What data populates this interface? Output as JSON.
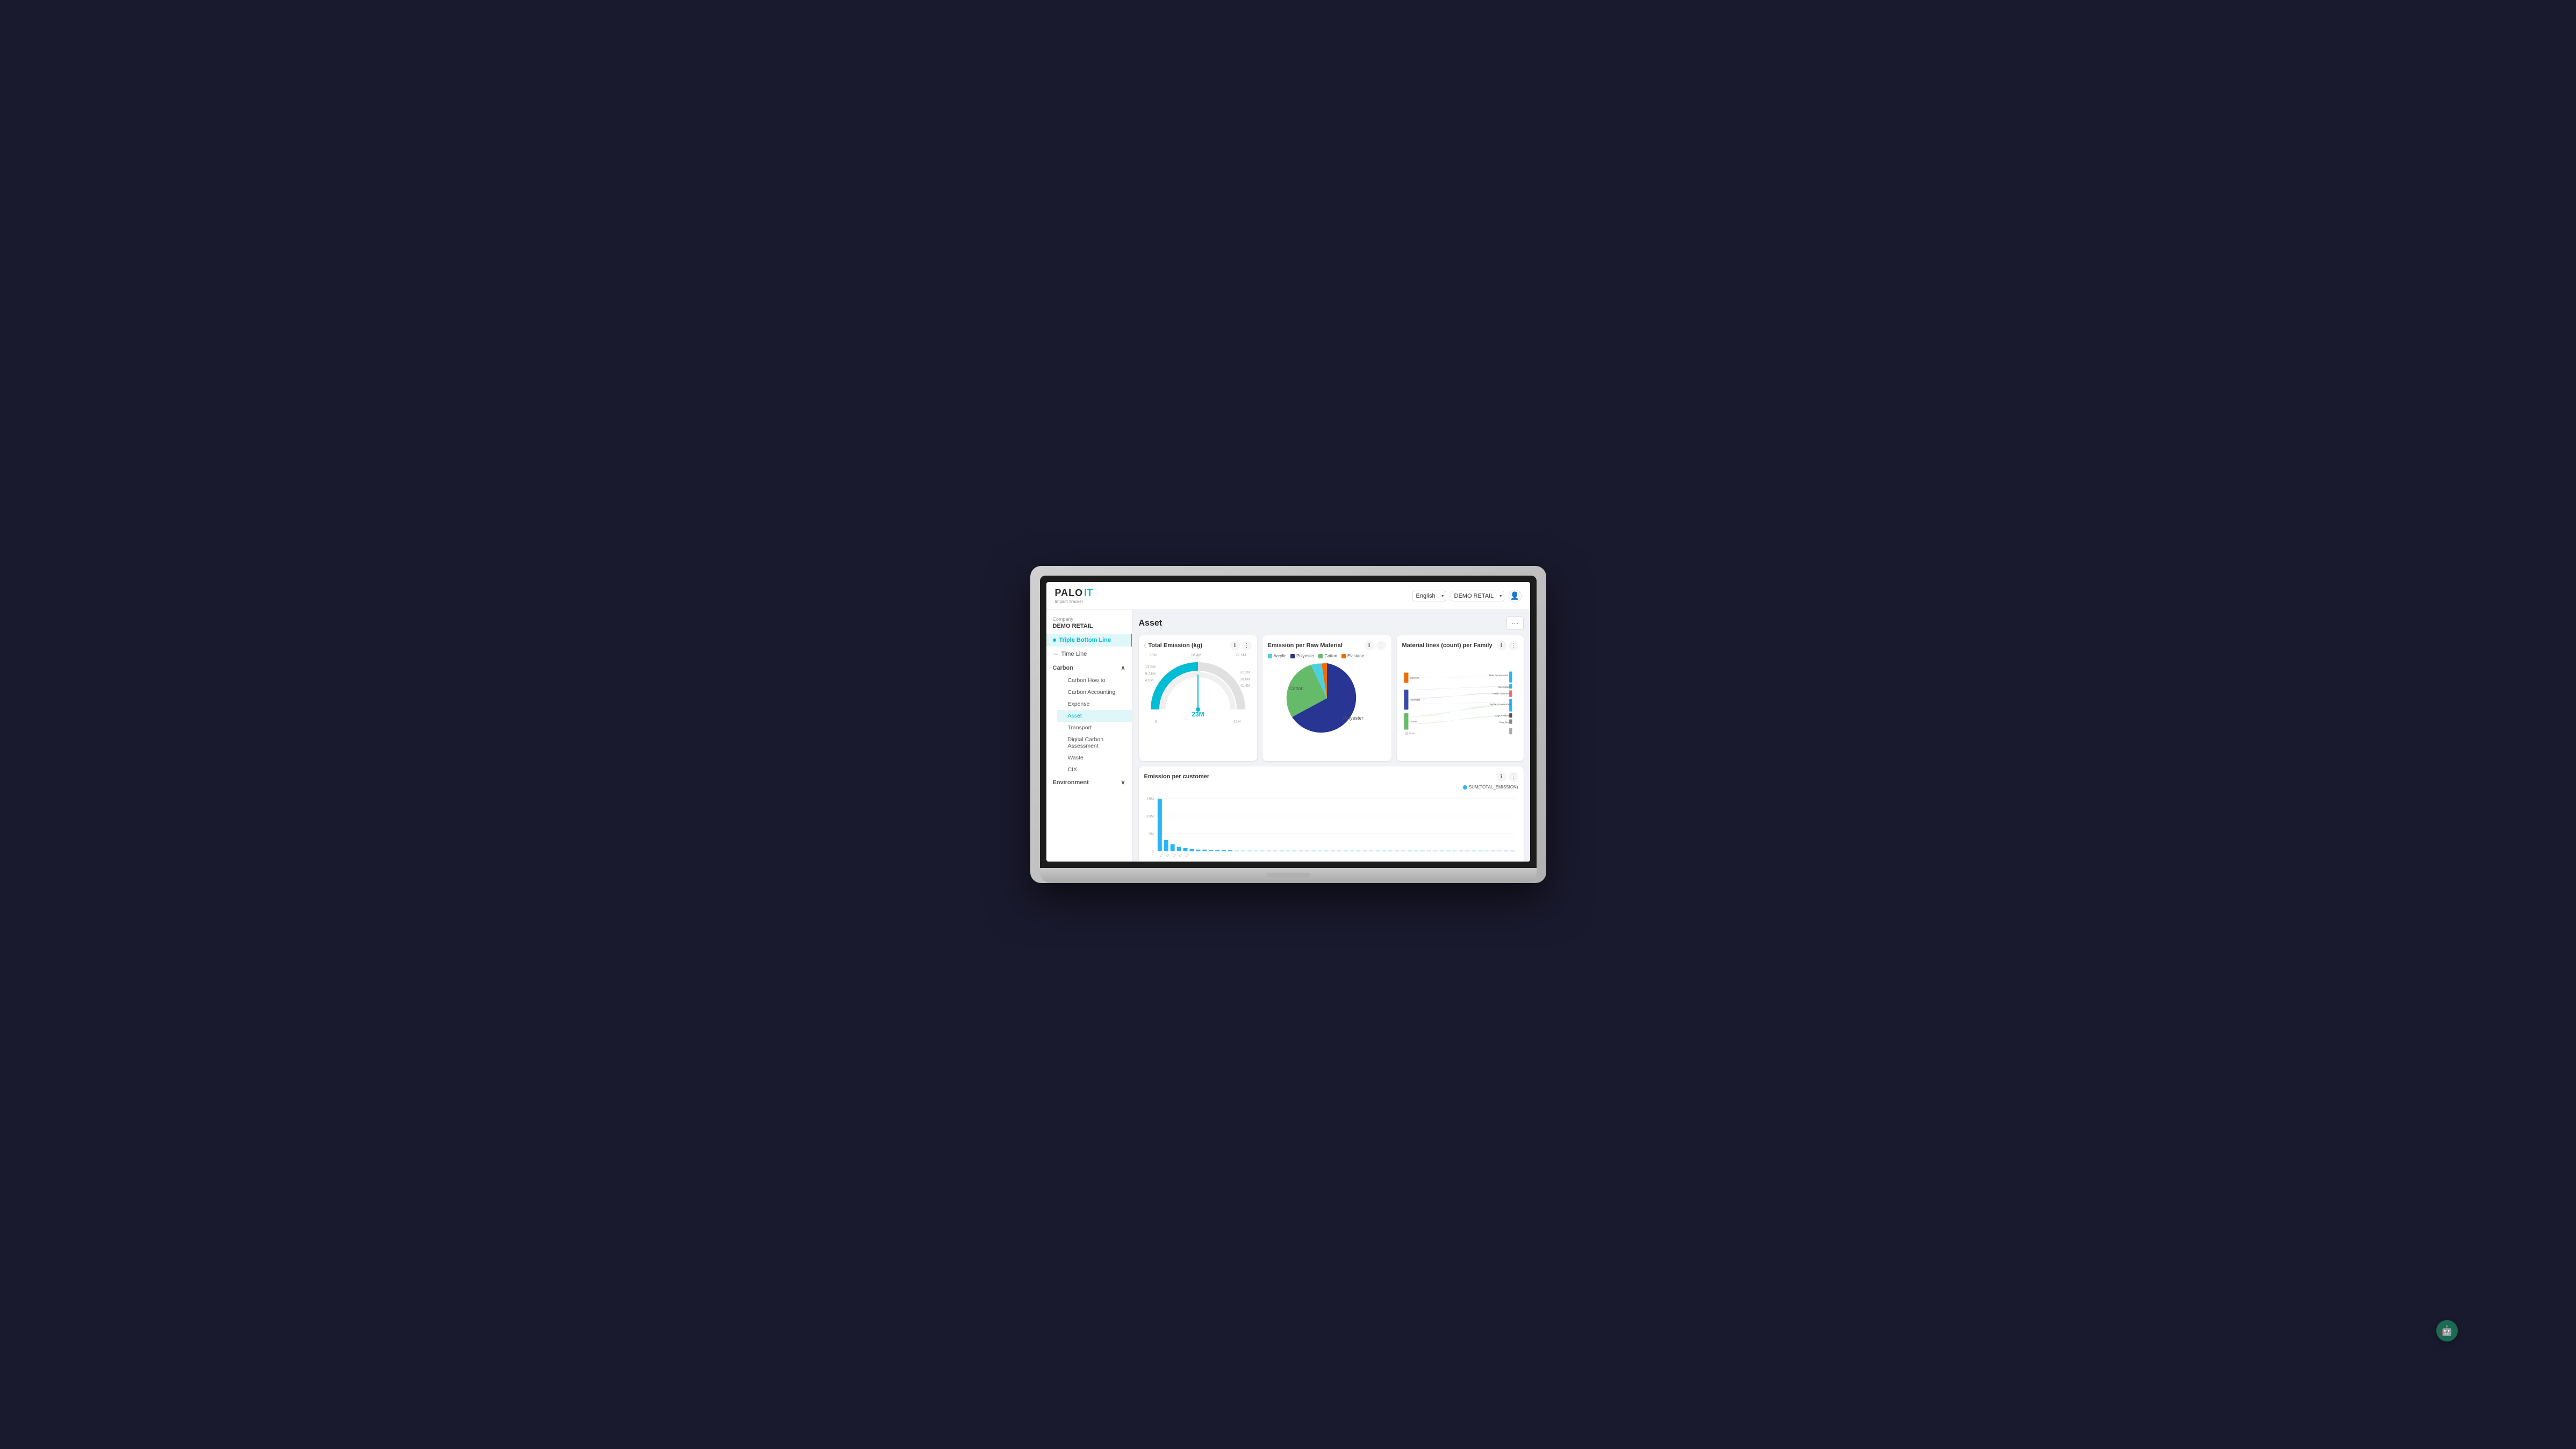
{
  "app": {
    "logo": {
      "palo": "PALO",
      "it": "IT",
      "subtitle": "Impact Tracker"
    },
    "header": {
      "lang_label": "English",
      "company_label": "DEMO RETAIL",
      "user_icon": "👤"
    },
    "sidebar": {
      "company_label": "Company",
      "company_name": "DEMO RETAIL",
      "items": [
        {
          "id": "triple-bottom-line",
          "label": "Triple Bottom Line",
          "active": true
        },
        {
          "id": "time-line",
          "label": "Time Line",
          "icon": "timeline"
        },
        {
          "id": "carbon",
          "label": "Carbon",
          "expandable": true,
          "expanded": true
        },
        {
          "id": "carbon-how-to",
          "label": "Carbon How to",
          "sub": true
        },
        {
          "id": "carbon-accounting",
          "label": "Carbon Accounting",
          "sub": true
        },
        {
          "id": "expense",
          "label": "Expense",
          "sub": true
        },
        {
          "id": "asset",
          "label": "Asset",
          "sub": true,
          "active": true
        },
        {
          "id": "transport",
          "label": "Transport",
          "sub": true
        },
        {
          "id": "digital-carbon",
          "label": "Digital Carbon Assessment",
          "sub": true
        },
        {
          "id": "waste",
          "label": "Waste",
          "sub": true
        },
        {
          "id": "cix",
          "label": "CIX",
          "sub": true
        },
        {
          "id": "environment",
          "label": "Environment",
          "expandable": true
        }
      ]
    },
    "page": {
      "title": "Asset",
      "more_btn": "⋯"
    },
    "total_emission": {
      "title": "Total Emission (kg)",
      "center_value": "23M",
      "gauge_labels": {
        "top_left": "13.8M",
        "top_right": "18.4M",
        "far_right": "27.6M",
        "right": "32.2M",
        "far_right2": "36.8M",
        "bottom_right": "41.4M",
        "bottom_far": "46M",
        "left": "9.21M",
        "left2": "4.6M",
        "bottom": "0"
      }
    },
    "emission_per_material": {
      "title": "Emission per Raw Material",
      "legend": [
        {
          "label": "Acrylic",
          "color": "#4dd0e1"
        },
        {
          "label": "Polyester",
          "color": "#283593"
        },
        {
          "label": "Cotton",
          "color": "#66bb6a"
        },
        {
          "label": "Elastane",
          "color": "#ef6c00"
        }
      ],
      "pie_labels": {
        "cotton": "Cotton",
        "polyester": "Polyester"
      }
    },
    "material_lines": {
      "title": "Material lines (count) per Family",
      "left_labels": [
        "Elastane",
        "Polyester",
        "Cotton"
      ],
      "right_labels": [
        "Hair Accessories",
        "Secondary",
        "Textile Garment",
        "Textile Accessories",
        "Bags Fashion",
        "Pouches",
        "None"
      ]
    },
    "emission_per_customer": {
      "title": "Emission per customer",
      "legend_label": "SUM(TOTAL_EMISSION)",
      "y_labels": [
        "15M",
        "10M",
        "5M",
        "0"
      ],
      "bar_color": "#29b6f6"
    }
  }
}
